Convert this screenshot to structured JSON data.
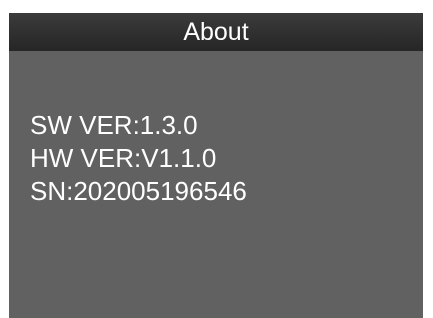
{
  "header": {
    "title": "About"
  },
  "info": {
    "sw_version": "SW VER:1.3.0",
    "hw_version": "HW VER:V1.1.0",
    "serial_number": "SN:202005196546"
  },
  "colors": {
    "screen_background": "#616161",
    "title_bar_background": "#2f2f2f",
    "text": "#ffffff"
  }
}
